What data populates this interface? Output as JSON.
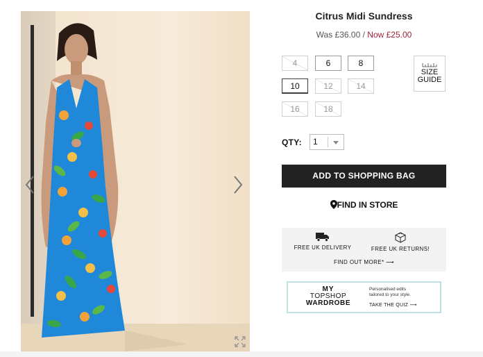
{
  "product": {
    "title": "Citrus Midi Sundress",
    "price_was": "Was £36.00",
    "price_sep": " / ",
    "price_now": "Now £25.00",
    "accent_color": "#9d2235"
  },
  "sizes": [
    {
      "label": "4",
      "state": "soldout"
    },
    {
      "label": "6",
      "state": "available"
    },
    {
      "label": "8",
      "state": "available"
    },
    {
      "label": "10",
      "state": "selected"
    },
    {
      "label": "12",
      "state": "soldout"
    },
    {
      "label": "14",
      "state": "soldout"
    },
    {
      "label": "16",
      "state": "soldout"
    },
    {
      "label": "18",
      "state": "soldout"
    }
  ],
  "size_guide": {
    "line1": "SIZE",
    "line2": "GUIDE",
    "icon": "ruler-icon"
  },
  "qty": {
    "label": "QTY:",
    "value": "1"
  },
  "add_to_bag": "ADD TO SHOPPING BAG",
  "find_in_store": "FIND IN STORE",
  "delivery": {
    "free_delivery": "FREE UK DELIVERY",
    "free_returns": "FREE UK RETURNS!",
    "find_out_more": "FIND OUT MORE* ⟶"
  },
  "wardrobe": {
    "line1": "MY",
    "line2": "TOPSHOP",
    "line3": "WARDROBE",
    "pitch_line1": "Personalised edits",
    "pitch_line2": "tailored to your style.",
    "cta": "TAKE THE QUIZ ⟶"
  },
  "gallery": {
    "prev_icon": "chevron-left-icon",
    "next_icon": "chevron-right-icon",
    "expand_icon": "expand-icon"
  }
}
